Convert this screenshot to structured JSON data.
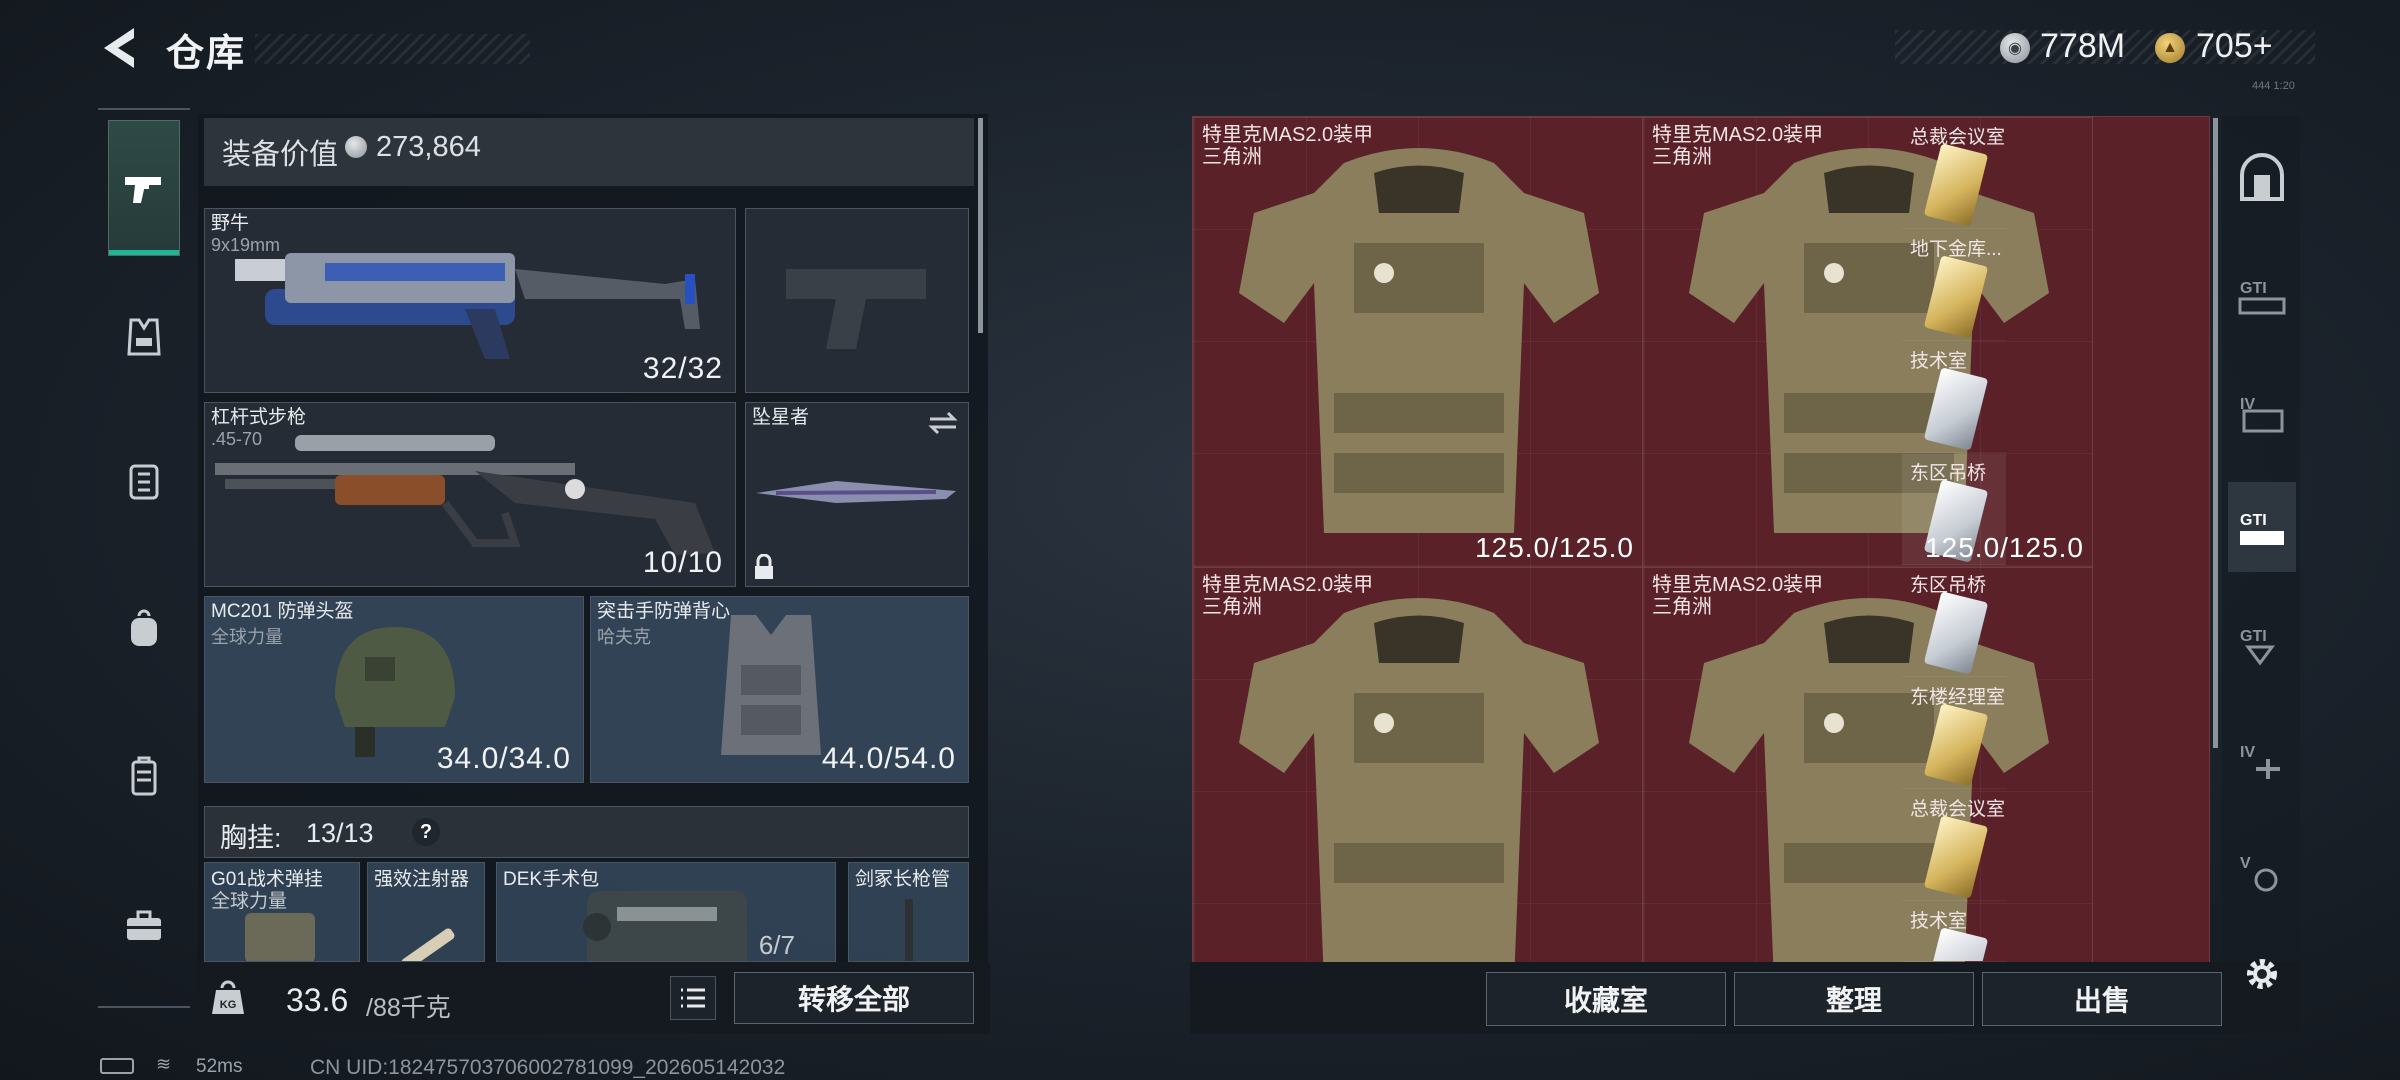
{
  "header": {
    "title": "仓库"
  },
  "currency": [
    {
      "icon": "silver-coin-icon",
      "value": "778M"
    },
    {
      "icon": "gold-coin-icon",
      "value": "705+"
    }
  ],
  "header_small_text": "444 1:20",
  "left_tabs": [
    {
      "icon": "pistol-icon",
      "selected": true
    },
    {
      "icon": "armor-vest-icon"
    },
    {
      "icon": "chest-rig-icon"
    },
    {
      "icon": "backpack-icon"
    },
    {
      "icon": "case-icon"
    },
    {
      "icon": "toolbox-icon"
    }
  ],
  "equipment": {
    "value_label": "装备价值",
    "value": "273,864",
    "slots": {
      "primary": {
        "name": "野牛",
        "sub": "9x19mm",
        "durability": "32/32"
      },
      "secondary": {
        "name": "",
        "sub": "",
        "durability": ""
      },
      "rifle": {
        "name": "杠杆式步枪",
        "sub": ".45-70",
        "durability": "10/10"
      },
      "melee": {
        "name": "坠星者",
        "locked": true
      },
      "helmet": {
        "name": "MC201 防弹头盔",
        "sub": "全球力量",
        "durability": "34.0/34.0"
      },
      "armor": {
        "name": "突击手防弹背心",
        "sub": "哈夫克",
        "durability": "44.0/54.0"
      }
    },
    "chest_rig": {
      "label": "胸挂:",
      "count": "13/13",
      "help": "?",
      "items": [
        {
          "name": "G01战术弹挂",
          "sub": "全球力量"
        },
        {
          "name": "强效注射器",
          "sub": ""
        },
        {
          "name": "DEK手术包",
          "sub": "",
          "count": "6/7"
        },
        {
          "name": "剑冢长枪管",
          "sub": ""
        }
      ]
    },
    "weight": {
      "current": "33.6",
      "max": "/88千克"
    },
    "transfer_all": "转移全部"
  },
  "status_bar": {
    "ping": "52ms",
    "uid": "CN UID:18247570370600278​1099_202605142032"
  },
  "container": {
    "items": [
      {
        "name": "特里克MAS2.0装甲",
        "sub": "三角洲",
        "durability": "125.0/125.0"
      },
      {
        "name": "特里克MAS2.0装甲",
        "sub": "三角洲",
        "durability": "125.0/125.0"
      },
      {
        "name": "特里克MAS2.0装甲",
        "sub": "三角洲",
        "durability": ""
      },
      {
        "name": "特里克MAS2.0装甲",
        "sub": "三角洲",
        "durability": ""
      }
    ],
    "keycards": [
      {
        "name": "总裁会议室",
        "color": "gold"
      },
      {
        "name": "地下金库...",
        "color": "gold"
      },
      {
        "name": "技术室",
        "color": "silver"
      },
      {
        "name": "东区吊桥",
        "color": "silver"
      },
      {
        "name": "东区吊桥",
        "color": "silver"
      },
      {
        "name": "东楼经理室",
        "color": "gold"
      },
      {
        "name": "总裁会议室",
        "color": "gold"
      },
      {
        "name": "技术室",
        "color": "silver"
      }
    ],
    "buttons": {
      "collection": "收藏室",
      "sort": "整理",
      "sell": "出售"
    }
  },
  "right_tabs": [
    {
      "icon": "vault-door-icon"
    },
    {
      "icon": "gti-storage-icon"
    },
    {
      "icon": "iv-storage-icon"
    },
    {
      "icon": "gti-storage-selected-icon",
      "selected": true
    },
    {
      "icon": "gti-storage-alt-icon"
    },
    {
      "icon": "iv-add-storage-icon"
    },
    {
      "icon": "v-storage-icon"
    }
  ],
  "colors": {
    "accent": "#1fb596",
    "container_bg": "#5a2128",
    "panel_bg": "#1b222b"
  }
}
